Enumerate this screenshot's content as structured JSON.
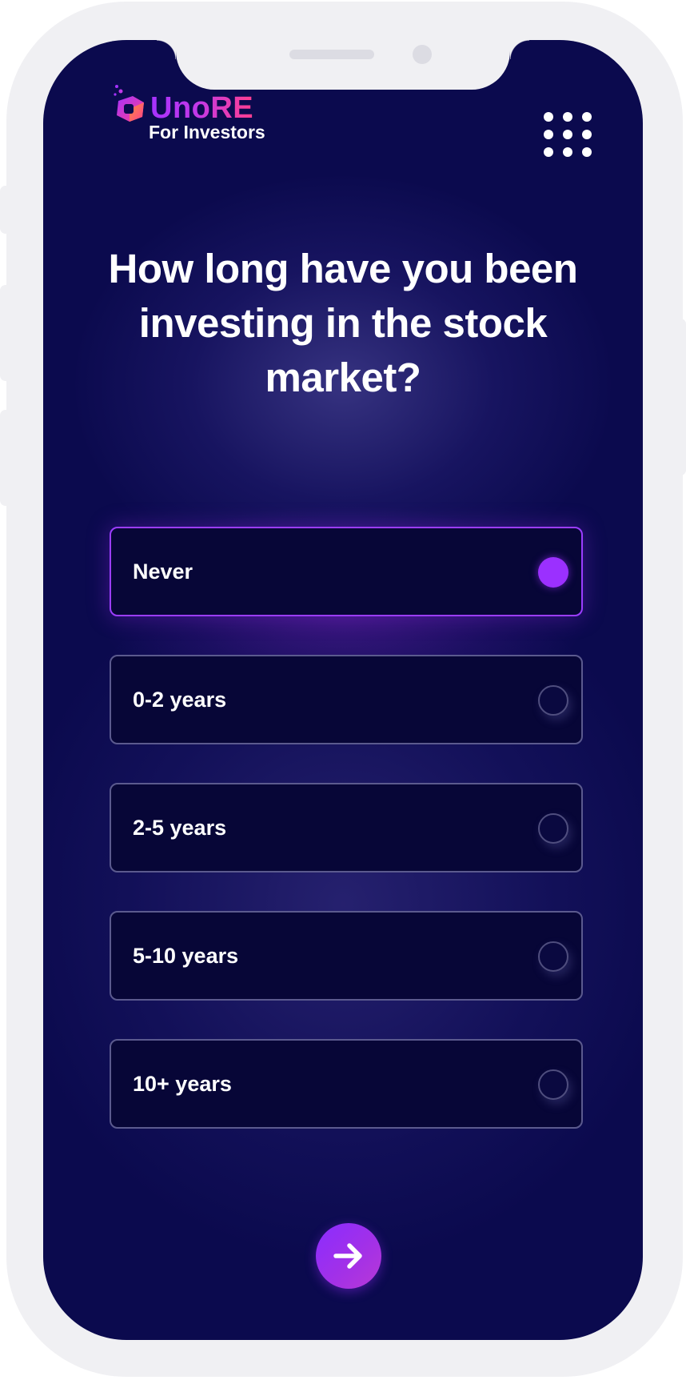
{
  "brand": {
    "name": "UnoRE",
    "subtitle": "For Investors"
  },
  "question": "How long have you been investing in the stock market?",
  "options": [
    {
      "label": "Never",
      "selected": true
    },
    {
      "label": "0-2 years",
      "selected": false
    },
    {
      "label": "2-5 years",
      "selected": false
    },
    {
      "label": "5-10 years",
      "selected": false
    },
    {
      "label": "10+ years",
      "selected": false
    }
  ],
  "icons": {
    "menu": "grid-menu-icon",
    "next": "arrow-right-icon",
    "logo": "unore-logo-icon"
  },
  "colors": {
    "background": "#0b0a4e",
    "option_background": "#070637",
    "accent": "#9b30ff",
    "brand_gradient_start": "#a632ff",
    "brand_gradient_end": "#ff3f8f",
    "frame": "#f0f0f3"
  }
}
